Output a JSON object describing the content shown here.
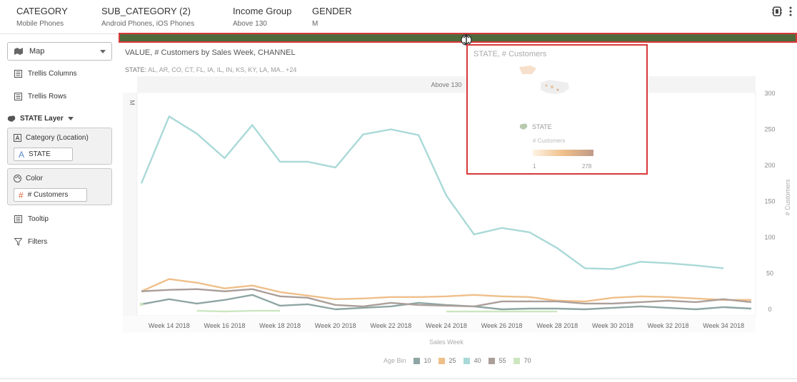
{
  "filters": [
    {
      "name": "CATEGORY",
      "value": "Mobile Phones"
    },
    {
      "name": "SUB_CATEGORY (2)",
      "value": "Android Phones, iOS Phones"
    },
    {
      "name": "Income Group",
      "value": "Above 130"
    },
    {
      "name": "GENDER",
      "value": "M"
    }
  ],
  "header_icons": [
    "filter-settings-icon",
    "more-options-icon"
  ],
  "left_panel": {
    "viz_type": "Map",
    "trellis_columns": "Trellis Columns",
    "trellis_rows": "Trellis Rows",
    "layer_title": "STATE Layer",
    "category_box": {
      "title": "Category (Location)",
      "chip": "STATE",
      "chip_glyph": "A"
    },
    "color_box": {
      "title": "Color",
      "chip": "# Customers",
      "chip_glyph": "#"
    },
    "tooltip": "Tooltip",
    "filters": "Filters"
  },
  "main": {
    "title": "VALUE, # Customers by Sales Week, CHANNEL",
    "state_filter_label": "STATE:",
    "state_filter_values": "AL, AR, CO, CT, FL, IA, IL, IN, KS, KY, LA, MA.. +24"
  },
  "popup": {
    "title": "STATE, # Customers",
    "layer_label": "STATE",
    "metric_label": "# Customers",
    "min": "1",
    "max": "278"
  },
  "colors": {
    "splitter": "#4f6b3c",
    "highlight": "#d9383a",
    "s10": "#8ea6a3",
    "s25": "#efbf8a",
    "s40": "#a9d9d8",
    "s55": "#ab9f9a",
    "s70": "#cde6c0"
  },
  "chart_data": {
    "type": "line",
    "trellis_column_header": "Above 130",
    "trellis_row_header": "M",
    "xlabel": "Sales Week",
    "ylabel": "# Customers",
    "ylim": [
      0,
      300
    ],
    "yticks": [
      0,
      50,
      100,
      150,
      200,
      250,
      300
    ],
    "x": [
      "Week 13 2018",
      "Week 14 2018",
      "Week 15 2018",
      "Week 16 2018",
      "Week 17 2018",
      "Week 18 2018",
      "Week 19 2018",
      "Week 20 2018",
      "Week 21 2018",
      "Week 22 2018",
      "Week 23 2018",
      "Week 24 2018",
      "Week 25 2018",
      "Week 26 2018",
      "Week 27 2018",
      "Week 28 2018",
      "Week 29 2018",
      "Week 30 2018",
      "Week 31 2018",
      "Week 32 2018",
      "Week 33 2018",
      "Week 34 2018",
      "Week 35 2018"
    ],
    "x_tick_labels": [
      "Week 14 2018",
      "Week 16 2018",
      "Week 18 2018",
      "Week 20 2018",
      "Week 22 2018",
      "Week 24 2018",
      "Week 26 2018",
      "Week 28 2018",
      "Week 30 2018",
      "Week 32 2018",
      "Week 34 2018"
    ],
    "legend_title": "Age Bin",
    "legend_position": "bottom",
    "grid": false,
    "series": [
      {
        "name": "10",
        "values": [
          7,
          14,
          8,
          13,
          20,
          5,
          7,
          0,
          2,
          4,
          9,
          6,
          4,
          0,
          1,
          1,
          0,
          2,
          4,
          2,
          0,
          3,
          1
        ]
      },
      {
        "name": "25",
        "values": [
          25,
          42,
          37,
          29,
          33,
          24,
          19,
          14,
          15,
          17,
          17,
          18,
          20,
          18,
          17,
          12,
          11,
          16,
          18,
          17,
          15,
          13,
          13
        ]
      },
      {
        "name": "40",
        "values": [
          175,
          268,
          244,
          210,
          256,
          205,
          205,
          197,
          243,
          250,
          242,
          158,
          104,
          113,
          107,
          85,
          57,
          56,
          66,
          64,
          61,
          57,
          null
        ]
      },
      {
        "name": "55",
        "values": [
          25,
          27,
          28,
          25,
          28,
          18,
          16,
          6,
          4,
          9,
          6,
          5,
          4,
          11,
          11,
          11,
          8,
          8,
          10,
          12,
          10,
          14,
          10
        ]
      },
      {
        "name": "70",
        "values": [
          7,
          null,
          -2,
          -3,
          -2,
          -2,
          null,
          null,
          null,
          null,
          null,
          -3,
          -3,
          -3,
          -3,
          -3,
          null,
          null,
          null,
          null,
          null,
          null,
          null
        ]
      }
    ]
  }
}
